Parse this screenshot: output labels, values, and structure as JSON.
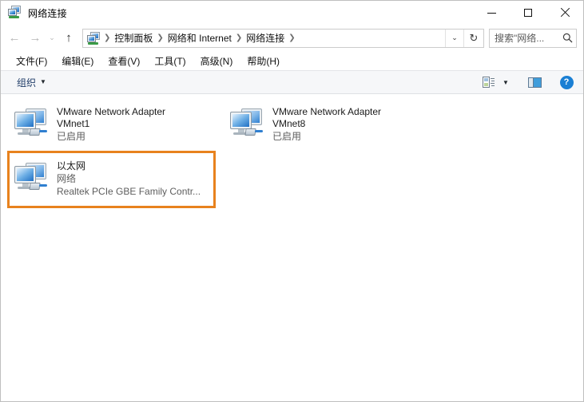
{
  "window": {
    "title": "网络连接",
    "title_icon": "network-connections-icon",
    "controls": {
      "minimize": "minimize-icon",
      "maximize": "maximize-icon",
      "close": "close-icon"
    }
  },
  "nav": {
    "back": "back-arrow-icon",
    "back_glyph": "←",
    "forward": "forward-arrow-icon",
    "forward_glyph": "→",
    "recent": "recent-locations-icon",
    "recent_glyph": "⌄",
    "up": "up-arrow-icon",
    "up_glyph": "↑"
  },
  "address": {
    "icon": "network-connections-icon",
    "crumbs": [
      "控制面板",
      "网络和 Internet",
      "网络连接"
    ],
    "separator": "❯",
    "dropdown_glyph": "⌄",
    "refresh_glyph": "↻"
  },
  "search": {
    "value": "搜索\"网络...",
    "icon": "search-icon",
    "icon_glyph": "🔍"
  },
  "menu": {
    "items": [
      {
        "label": "文件(F)",
        "name": "menu-file"
      },
      {
        "label": "编辑(E)",
        "name": "menu-edit"
      },
      {
        "label": "查看(V)",
        "name": "menu-view"
      },
      {
        "label": "工具(T)",
        "name": "menu-tools"
      },
      {
        "label": "高级(N)",
        "name": "menu-advanced"
      },
      {
        "label": "帮助(H)",
        "name": "menu-help"
      }
    ]
  },
  "toolbar": {
    "organize_label": "组织",
    "organize_caret": "▼",
    "view_caret": "▼",
    "view_icon": "change-view-icon",
    "preview_pane_icon": "preview-pane-icon",
    "help_icon": "help-icon",
    "help_glyph": "?"
  },
  "connections": [
    {
      "name": "VMware Network Adapter\nVMnet1",
      "status": "已启用",
      "detail": "",
      "icon": "network-adapter-icon",
      "selected": false
    },
    {
      "name": "VMware Network Adapter\nVMnet8",
      "status": "已启用",
      "detail": "",
      "icon": "network-adapter-icon",
      "selected": false
    },
    {
      "name": "以太网",
      "status": "网络",
      "detail": "Realtek PCIe GBE Family Contr...",
      "icon": "network-adapter-icon",
      "selected": false
    }
  ],
  "annotation": {
    "color": "#e8821e",
    "target": "ethernet-connection-tile"
  }
}
